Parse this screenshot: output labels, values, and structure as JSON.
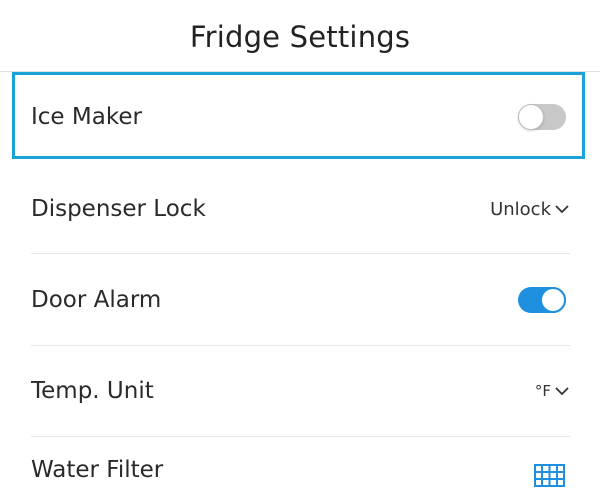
{
  "header": {
    "title": "Fridge Settings"
  },
  "settings": {
    "ice_maker": {
      "label": "Ice Maker",
      "state": "off"
    },
    "dispenser_lock": {
      "label": "Dispenser Lock",
      "value": "Unlock"
    },
    "door_alarm": {
      "label": "Door Alarm",
      "state": "on"
    },
    "temp_unit": {
      "label": "Temp. Unit",
      "value": "°F"
    },
    "water_filter": {
      "label": "Water Filter",
      "icon": "grid-icon"
    }
  },
  "colors": {
    "focus": "#1ba3d8",
    "toggle_on": "#1f8fe0",
    "toggle_off": "#c8c8c8",
    "filter_icon": "#1f8fe0"
  }
}
